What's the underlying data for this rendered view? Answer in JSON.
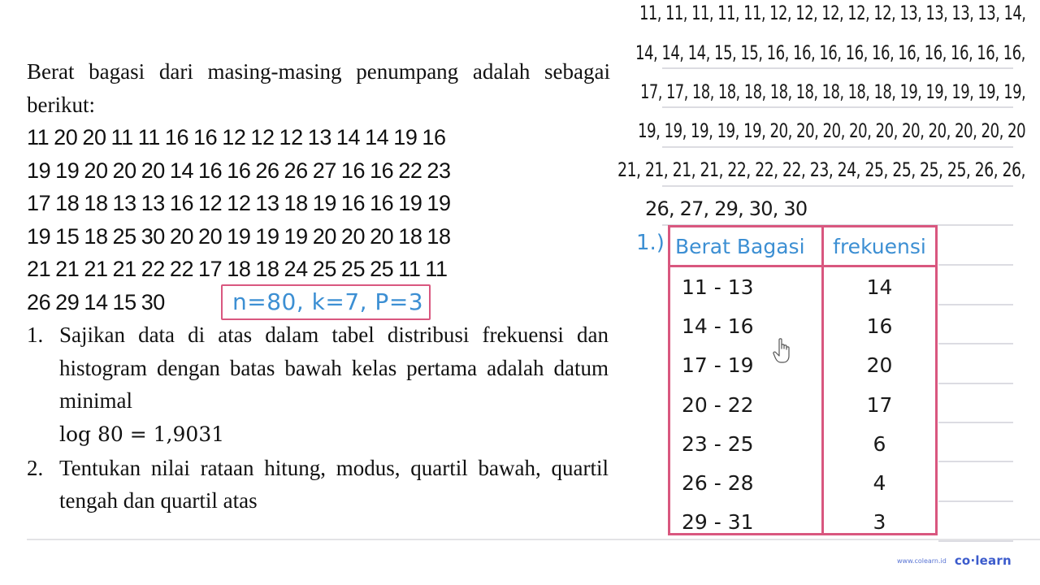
{
  "question": {
    "intro": "Berat bagasi dari masing-masing penumpang adalah sebagai berikut:",
    "data_rows": [
      [
        "11",
        "20",
        "20",
        "11",
        "11",
        "16",
        "16",
        "12",
        "12",
        "12",
        "13",
        "14",
        "14",
        "19",
        "16"
      ],
      [
        "19",
        "19",
        "20",
        "20",
        "20",
        "14",
        "16",
        "16",
        "26",
        "26",
        "27",
        "16",
        "16",
        "22",
        "23"
      ],
      [
        "17",
        "18",
        "18",
        "13",
        "13",
        "16",
        "12",
        "12",
        "13",
        "18",
        "19",
        "16",
        "16",
        "19",
        "19"
      ],
      [
        "19",
        "15",
        "18",
        "25",
        "30",
        "20",
        "20",
        "19",
        "19",
        "19",
        "20",
        "20",
        "20",
        "18",
        "18"
      ],
      [
        "21",
        "21",
        "21",
        "21",
        "22",
        "22",
        "17",
        "18",
        "18",
        "24",
        "25",
        "25",
        "25",
        "11",
        "11"
      ],
      [
        "26",
        "29",
        "14",
        "15",
        "30"
      ]
    ],
    "given_annotation": "n=80, k=7, P=3",
    "tasks": [
      {
        "number": "1.",
        "text": "Sajikan data di atas dalam tabel distribusi frekuensi dan histogram dengan batas bawah kelas pertama adalah datum minimal",
        "math": "log 80 = 1,9031"
      },
      {
        "number": "2.",
        "text": "Tentukan nilai rataan hitung, modus, quartil bawah, quartil tengah dan quartil atas"
      }
    ]
  },
  "worksheet": {
    "sorted_data_lines": [
      "11, 11, 11, 11, 11, 12, 12, 12, 12, 12, 13, 13, 13, 13, 14,",
      "14, 14, 14, 15, 15, 16, 16, 16, 16, 16, 16, 16, 16, 16, 16,",
      "17, 17, 18, 18, 18, 18, 18, 18, 18, 18, 19, 19, 19, 19, 19,",
      "19, 19, 19, 19, 19, 20, 20, 20, 20, 20, 20, 20, 20, 20, 20",
      "21, 21, 21, 21, 22, 22, 22, 23, 24, 25, 25, 25, 25, 26, 26,",
      "26, 27, 29, 30, 30"
    ],
    "step_label": "1.)",
    "table": {
      "headers": [
        "Berat Bagasi",
        "frekuensi"
      ],
      "rows": [
        {
          "class": "11 - 13",
          "frequency": "14"
        },
        {
          "class": "14 - 16",
          "frequency": "16"
        },
        {
          "class": "17 - 19",
          "frequency": "20"
        },
        {
          "class": "20 - 22",
          "frequency": "17"
        },
        {
          "class": "23 - 25",
          "frequency": "6"
        },
        {
          "class": "26 - 28",
          "frequency": "4"
        },
        {
          "class": "29 - 31",
          "frequency": "3"
        }
      ]
    }
  },
  "footer": {
    "url": "www.colearn.id",
    "logo": "co·learn"
  },
  "colors": {
    "ink_black": "#1a1a1a",
    "ink_blue": "#3c8fd3",
    "table_pink": "#d9577f",
    "ruled_line": "#dcdce2",
    "brand_blue": "#3b5bcc"
  }
}
